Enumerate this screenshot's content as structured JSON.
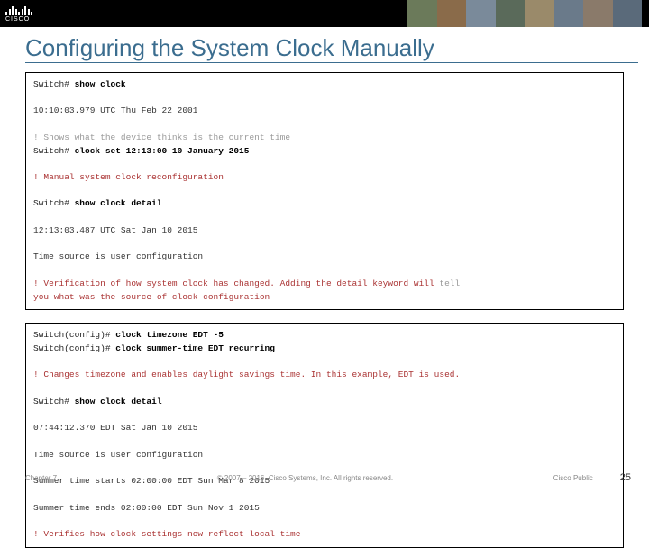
{
  "logo_text": "CISCO",
  "title": "Configuring the System Clock Manually",
  "box1": {
    "l1_prompt": "Switch# ",
    "l1_cmd": "show clock",
    "l2": "10:10:03.979 UTC Thu Feb 22 2001",
    "l3": "! Shows what the device thinks is the current time",
    "l4_prompt": "Switch# ",
    "l4_cmd": "clock set 12:13:00 10 January 2015",
    "l5": "! Manual system clock reconfiguration",
    "l6_prompt": "Switch# ",
    "l6_cmd": "show clock detail",
    "l7": "12:13:03.487 UTC Sat Jan 10 2015",
    "l8": "Time source is user configuration",
    "l9a": "! Verification of how system clock has changed. Adding the detail keyword will ",
    "l9b": "tell",
    "l10": "you what was the source of clock configuration"
  },
  "box2": {
    "l1_prompt": "Switch(config)# ",
    "l1_cmd": "clock timezone EDT -5",
    "l2_prompt": "Switch(config)# ",
    "l2_cmd": "clock summer-time EDT recurring",
    "l3": "! Changes timezone and enables daylight savings time. In this example, EDT is used.",
    "l4_prompt": "Switch# ",
    "l4_cmd": "show clock detail",
    "l5": "07:44:12.370 EDT Sat Jan 10 2015",
    "l6": "Time source is user configuration",
    "l7": "Summer time starts 02:00:00 EDT Sun Mar 8 2015",
    "l8": "Summer time ends 02:00:00 EDT Sun Nov 1 2015",
    "l9": "! Verifies how clock settings now reflect local time"
  },
  "footer": {
    "chapter": "Chapter 7",
    "copyright": "© 2007 – 2016, Cisco Systems, Inc. All rights reserved.",
    "public": "Cisco Public",
    "page": "25"
  }
}
